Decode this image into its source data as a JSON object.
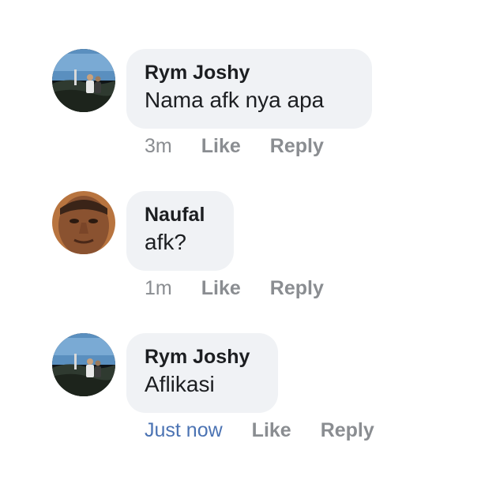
{
  "comments": [
    {
      "author": "Rym Joshy",
      "text": "Nama afk nya apa",
      "time": "3m",
      "like_label": "Like",
      "reply_label": "Reply"
    },
    {
      "author": "Naufal",
      "text": "afk?",
      "time": "1m",
      "like_label": "Like",
      "reply_label": "Reply"
    },
    {
      "author": "Rym Joshy",
      "text": "Aflikasi",
      "time": "Just now",
      "like_label": "Like",
      "reply_label": "Reply"
    }
  ],
  "colors": {
    "bubble": "#f0f2f5",
    "author_text": "#1c1e21",
    "meta_text": "#8a8d91",
    "just_now_text": "#4b73b3"
  },
  "icons": {
    "avatar_1": "landscape-photo-avatar",
    "avatar_2": "face-photo-avatar",
    "avatar_3": "landscape-photo-avatar"
  }
}
